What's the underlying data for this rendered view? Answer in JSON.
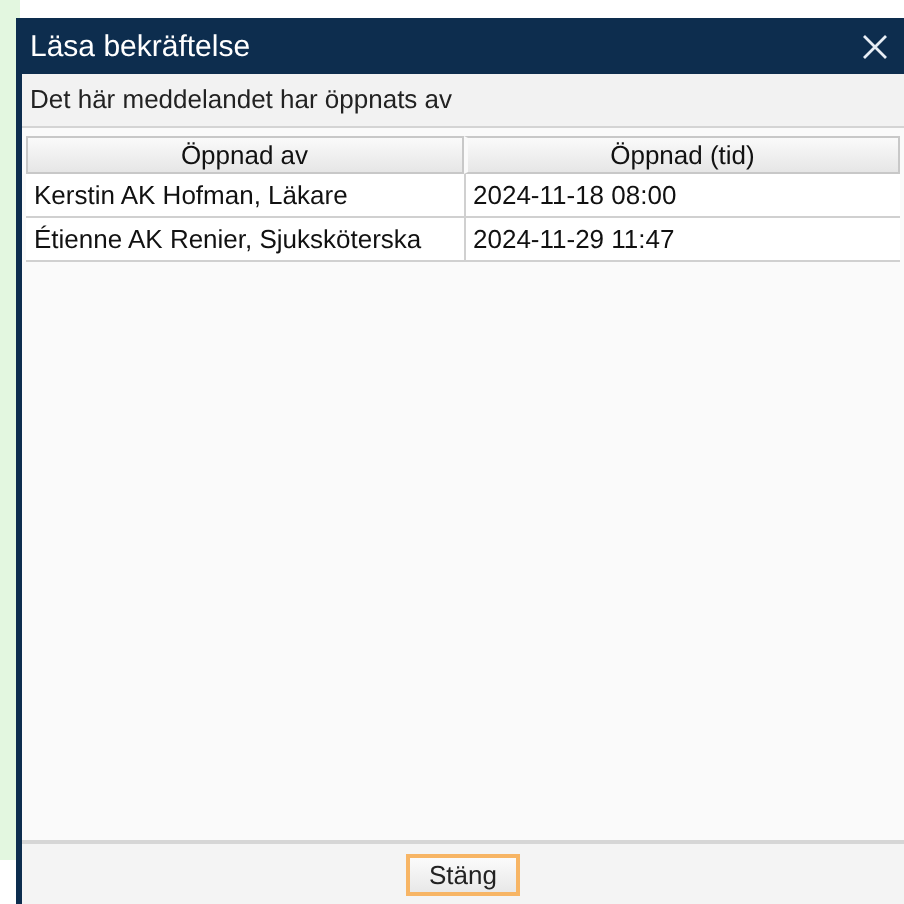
{
  "window": {
    "title": "Läsa bekräftelse"
  },
  "message": "Det här meddelandet har öppnats av",
  "table": {
    "columns": [
      "Öppnad av",
      "Öppnad (tid)"
    ],
    "rows": [
      [
        "Kerstin AK Hofman, Läkare",
        "2024-11-18 08:00"
      ],
      [
        "Étienne AK Renier, Sjuksköterska",
        "2024-11-29 11:47"
      ]
    ]
  },
  "buttons": [
    "Stäng"
  ]
}
